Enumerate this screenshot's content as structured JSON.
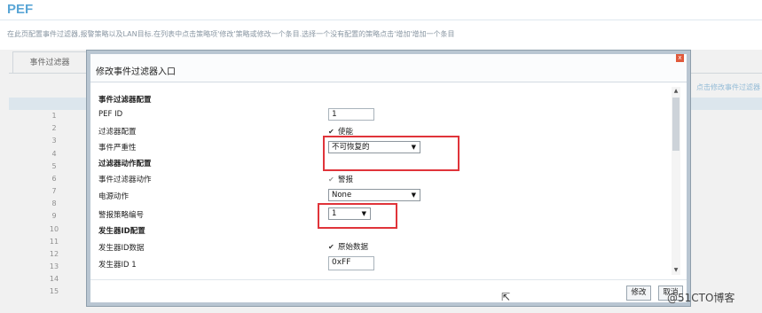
{
  "page": {
    "title": "PEF",
    "description": "在此页配置事件过滤器,报警策略以及LAN目标.在列表中点击策略项'修改'策略或修改一个条目.选择一个没有配置的策略点击'增加'增加一个条目",
    "tab_label": "事件过滤器",
    "side_link": "点击修改事件过滤器",
    "row_numbers": [
      "1",
      "2",
      "3",
      "4",
      "5",
      "6",
      "7",
      "8",
      "9",
      "10",
      "11",
      "12",
      "13",
      "14",
      "15"
    ]
  },
  "dialog": {
    "title": "修改事件过滤器入口",
    "close_label": "x",
    "fields": {
      "section_config": "事件过滤器配置",
      "pef_id_label": "PEF ID",
      "pef_id_value": "1",
      "filter_config_label": "过滤器配置",
      "filter_enable_label": "使能",
      "severity_label": "事件严重性",
      "severity_value": "不可恢复的",
      "section_action": "过滤器动作配置",
      "filter_action_label": "事件过滤器动作",
      "alert_label": "警报",
      "power_action_label": "电源动作",
      "power_action_value": "None",
      "alert_policy_label": "警报策略编号",
      "alert_policy_value": "1",
      "section_generator": "发生器ID配置",
      "generator_data_label": "发生器ID数据",
      "raw_data_label": "原始数据",
      "generator_id1_label": "发生器ID 1",
      "generator_id1_value": "0xFF"
    },
    "buttons": {
      "modify": "修改",
      "cancel": "取消"
    },
    "highlight_color": "#e0343a"
  },
  "watermark": "@51CTO博客",
  "colors": {
    "title": "#5aa6d6",
    "dialog_border": "#b9c6d2"
  }
}
